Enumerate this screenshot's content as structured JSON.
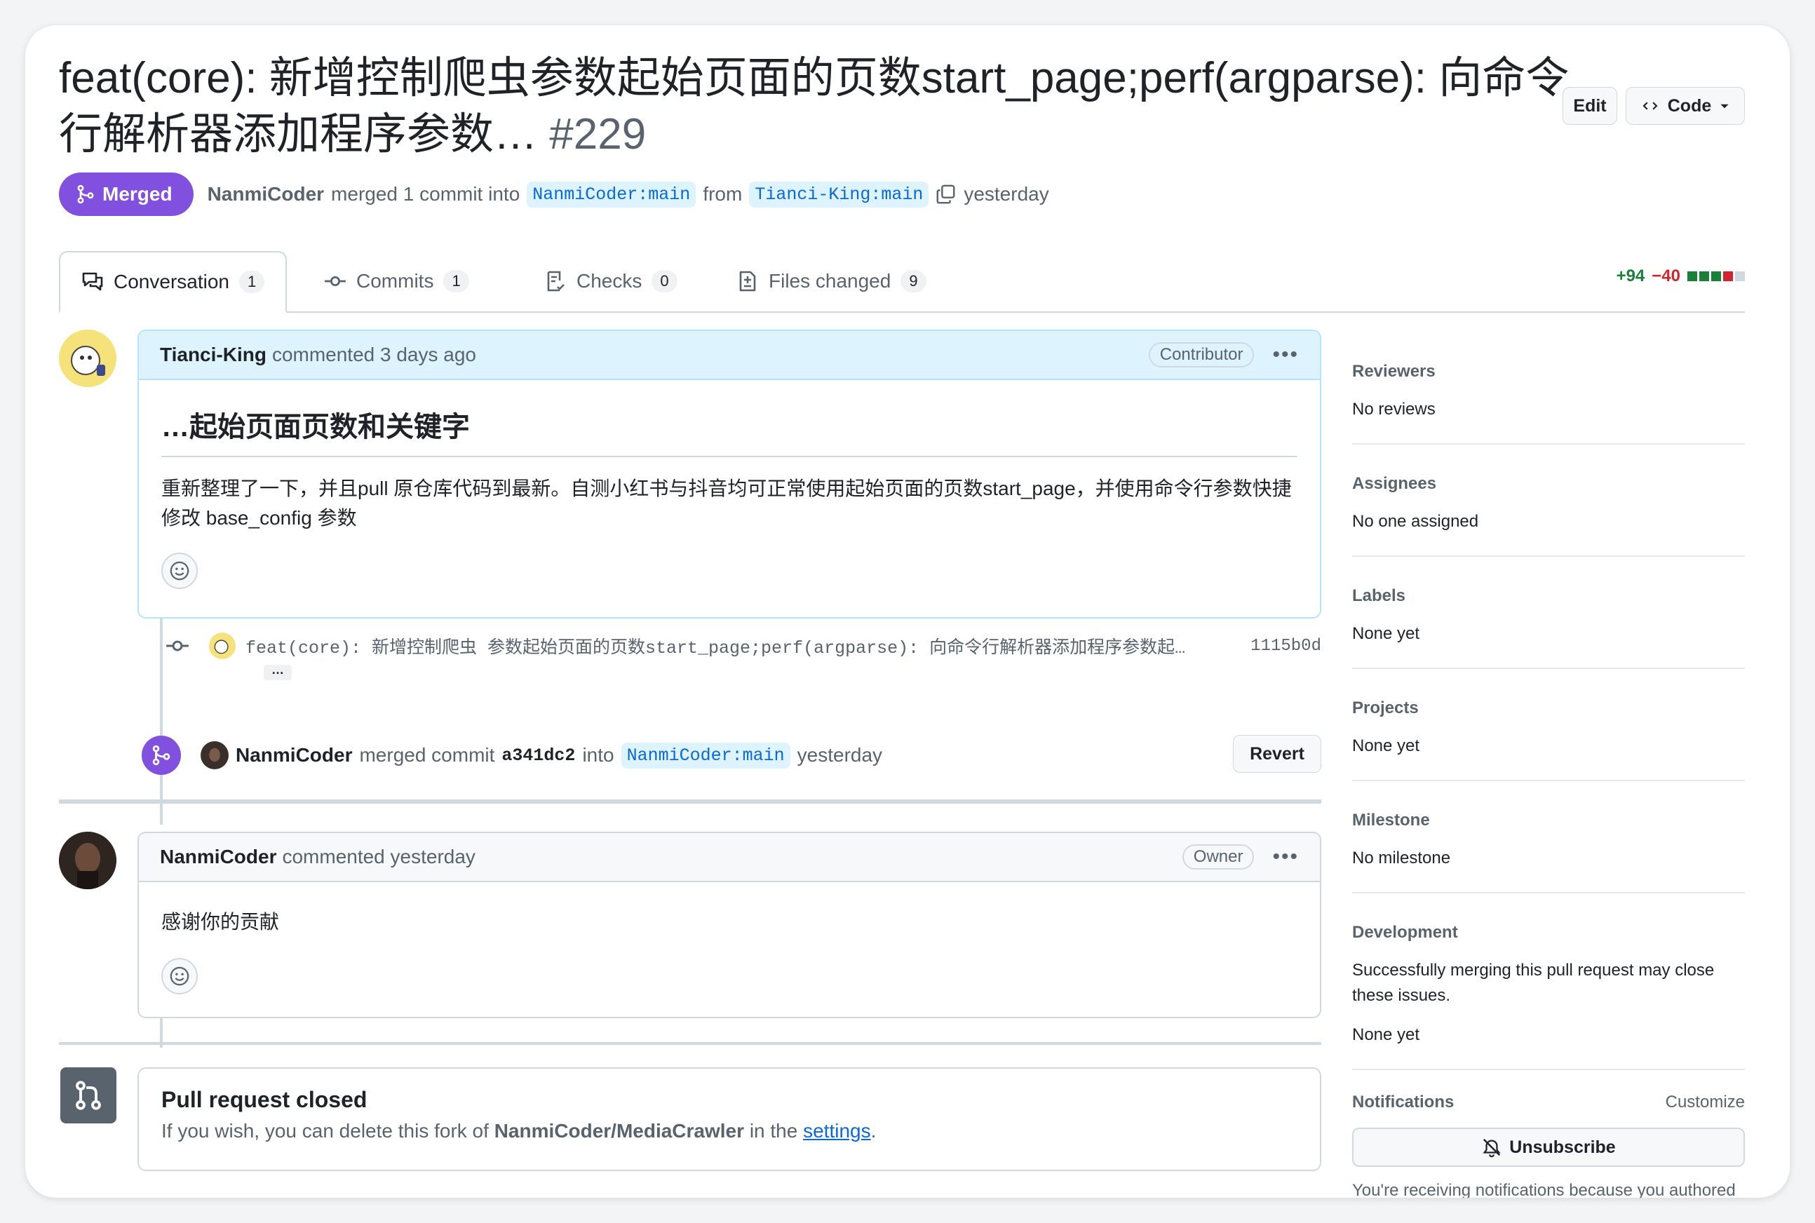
{
  "header": {
    "title": "feat(core): 新增控制爬虫参数起始页面的页数start_page;perf(argparse): 向命令行解析器添加程序参数…",
    "number": "#229",
    "edit_label": "Edit",
    "code_label": "Code"
  },
  "status": {
    "state": "Merged",
    "merger": "NanmiCoder",
    "action_text": "merged 1 commit into",
    "base_branch": "NanmiCoder:main",
    "from_text": "from",
    "head_branch": "Tianci-King:main",
    "time": "yesterday"
  },
  "tabs": [
    {
      "label": "Conversation",
      "count": "1"
    },
    {
      "label": "Commits",
      "count": "1"
    },
    {
      "label": "Checks",
      "count": "0"
    },
    {
      "label": "Files changed",
      "count": "9"
    }
  ],
  "diffstat": {
    "additions": "+94",
    "deletions": "−40"
  },
  "colors": {
    "merged": "#8250df",
    "add": "#1a7f37",
    "del": "#d1242f",
    "link": "#0969da"
  },
  "comment1": {
    "author": "Tianci-King",
    "meta": "commented 3 days ago",
    "role": "Contributor",
    "heading": "…起始页面页数和关键字",
    "body": "重新整理了一下，并且pull 原仓库代码到最新。自测小红书与抖音均可正常使用起始页面的页数start_page，并使用命令行参数快捷修改 base_config 参数"
  },
  "commit": {
    "message": "feat(core): 新增控制爬虫 参数起始页面的页数start_page;perf(argparse): 向命令行解析器添加程序参数起…",
    "hash": "1115b0d",
    "expand": "…"
  },
  "merge_event": {
    "user": "NanmiCoder",
    "text": "merged commit",
    "commit": "a341dc2",
    "into": "into",
    "branch": "NanmiCoder:main",
    "time": "yesterday",
    "revert_label": "Revert"
  },
  "comment2": {
    "author": "NanmiCoder",
    "meta": "commented yesterday",
    "role": "Owner",
    "body": "感谢你的贡献"
  },
  "closed": {
    "title": "Pull request closed",
    "text_before": "If you wish, you can delete this fork of",
    "repo": "NanmiCoder/MediaCrawler",
    "text_mid": "in the",
    "link": "settings",
    "text_end": "."
  },
  "sidebar": {
    "reviewers": {
      "title": "Reviewers",
      "value": "No reviews"
    },
    "assignees": {
      "title": "Assignees",
      "value": "No one assigned"
    },
    "labels": {
      "title": "Labels",
      "value": "None yet"
    },
    "projects": {
      "title": "Projects",
      "value": "None yet"
    },
    "milestone": {
      "title": "Milestone",
      "value": "No milestone"
    },
    "development": {
      "title": "Development",
      "note": "Successfully merging this pull request may close these issues.",
      "value": "None yet"
    },
    "notifications": {
      "title": "Notifications",
      "customize": "Customize",
      "button": "Unsubscribe",
      "note": "You're receiving notifications because you authored the thread."
    }
  }
}
